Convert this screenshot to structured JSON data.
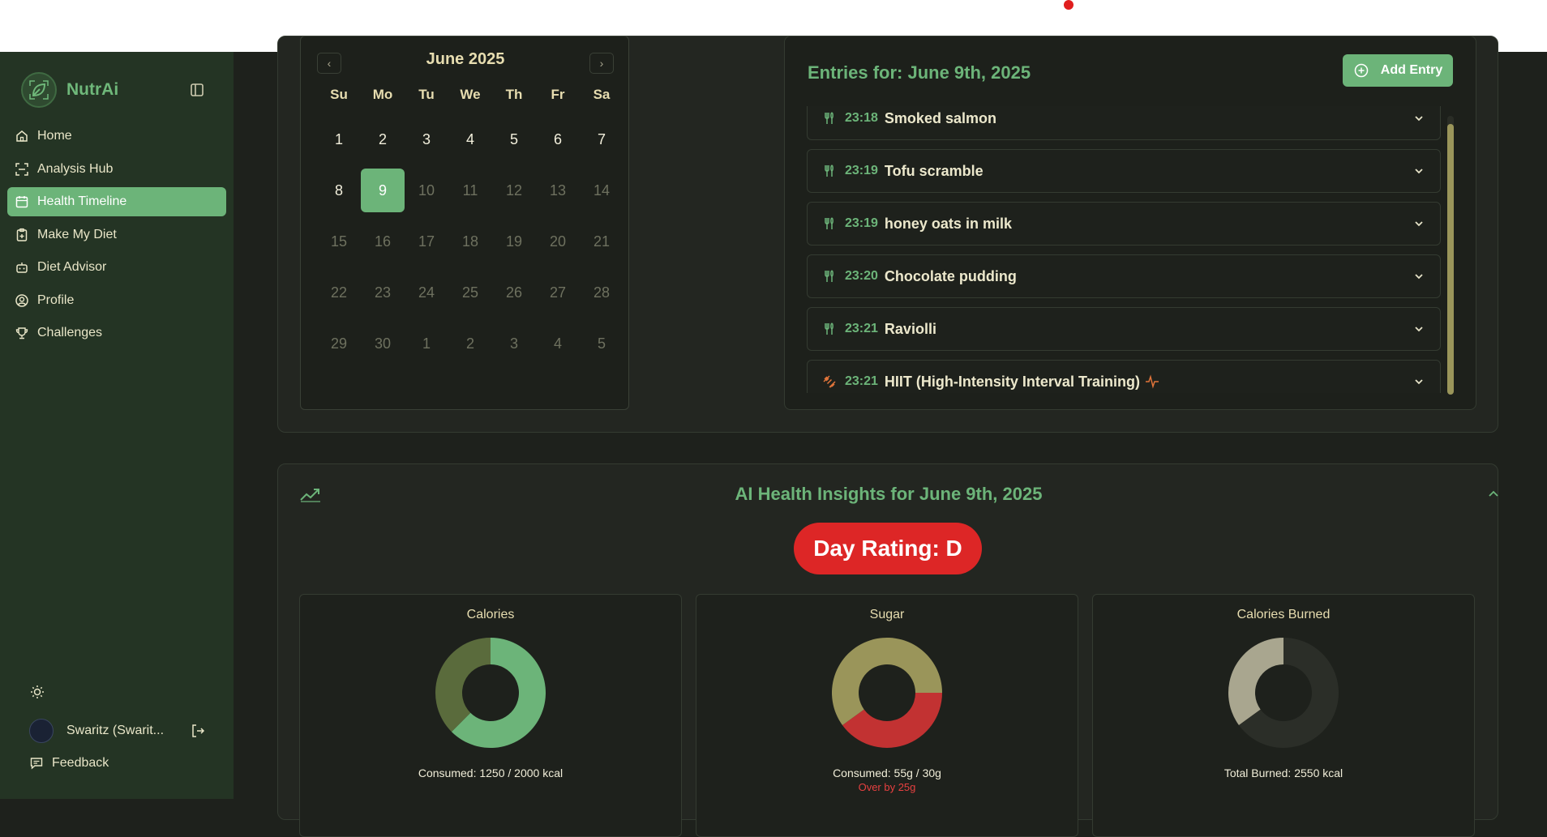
{
  "app": {
    "name": "NutrAi"
  },
  "sidebar": {
    "items": [
      {
        "label": "Home",
        "icon": "home-icon"
      },
      {
        "label": "Analysis Hub",
        "icon": "scan-icon"
      },
      {
        "label": "Health Timeline",
        "icon": "calendar-icon",
        "active": true
      },
      {
        "label": "Make My Diet",
        "icon": "clipboard-plus-icon"
      },
      {
        "label": "Diet Advisor",
        "icon": "bot-icon"
      },
      {
        "label": "Profile",
        "icon": "user-circle-icon"
      },
      {
        "label": "Challenges",
        "icon": "trophy-icon"
      }
    ],
    "user_name": "Swaritz (Swarit...",
    "feedback_label": "Feedback"
  },
  "calendar": {
    "title": "June 2025",
    "weekdays": [
      "Su",
      "Mo",
      "Tu",
      "We",
      "Th",
      "Fr",
      "Sa"
    ],
    "weeks": [
      [
        "1",
        "2",
        "3",
        "4",
        "5",
        "6",
        "7"
      ],
      [
        "8",
        "9",
        "10",
        "11",
        "12",
        "13",
        "14"
      ],
      [
        "15",
        "16",
        "17",
        "18",
        "19",
        "20",
        "21"
      ],
      [
        "22",
        "23",
        "24",
        "25",
        "26",
        "27",
        "28"
      ],
      [
        "29",
        "30",
        "1",
        "2",
        "3",
        "4",
        "5"
      ]
    ],
    "selected": "9"
  },
  "entries": {
    "title": "Entries for: June 9th, 2025",
    "add_label": "Add Entry",
    "items": [
      {
        "time": "23:18",
        "title": "Smoked salmon",
        "type": "meal"
      },
      {
        "time": "23:19",
        "title": "Tofu scramble",
        "type": "meal"
      },
      {
        "time": "23:19",
        "title": "honey oats in milk",
        "type": "meal"
      },
      {
        "time": "23:20",
        "title": "Chocolate pudding",
        "type": "meal"
      },
      {
        "time": "23:21",
        "title": "Raviolli",
        "type": "meal"
      },
      {
        "time": "23:21",
        "title": "HIIT (High-Intensity Interval Training)",
        "type": "exercise"
      }
    ]
  },
  "insights": {
    "title": "AI Health Insights for June 9th, 2025",
    "rating": "Day Rating: D",
    "cards": [
      {
        "title": "Calories",
        "subtitle": "Consumed: 1250 / 2000 kcal",
        "warning": "",
        "fraction": 0.625,
        "fill": "#6cb479",
        "rest": "#5a6b3c"
      },
      {
        "title": "Sugar",
        "subtitle": "Consumed: 55g / 30g",
        "warning": "Over by 25g",
        "fraction": 0.6,
        "fill": "#9a955a",
        "rest": "#c23232"
      },
      {
        "title": "Calories Burned",
        "subtitle": "Total Burned: 2550 kcal",
        "warning": "",
        "fraction": 0.35,
        "fill": "#a9a68f",
        "rest": "#2b2e28"
      }
    ]
  },
  "colors": {
    "accent": "#6cb479",
    "danger": "#dd2626",
    "sidebar": "#243424"
  }
}
